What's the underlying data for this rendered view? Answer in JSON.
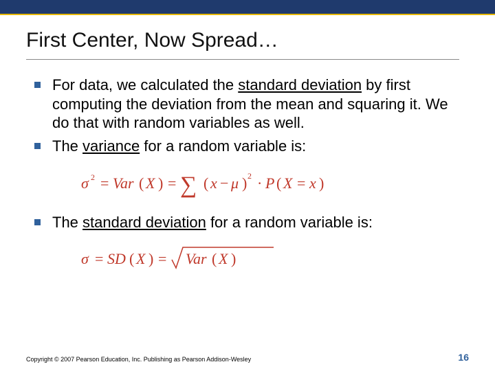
{
  "slide": {
    "title": "First Center, Now Spread…",
    "bullets": {
      "b1_a": "For data, we calculated the ",
      "b1_b": "standard deviation",
      "b1_c": " by first computing the deviation from the mean and squaring it. We do that with random variables as well.",
      "b2_a": "The ",
      "b2_b": "variance",
      "b2_c": " for a random variable is:",
      "b3_a": "The ",
      "b3_b": "standard deviation",
      "b3_c": " for a random variable is:"
    },
    "formulas": {
      "variance_plain": "σ² = Var(X) = Σ (x − μ)² · P(X = x)",
      "sd_plain": "σ = SD(X) = √Var(X)"
    },
    "footer": {
      "copyright": "Copyright © 2007 Pearson Education, Inc. Publishing as Pearson Addison-Wesley",
      "page": "16"
    },
    "colors": {
      "band": "#1f3a6d",
      "accent": "#e6b800",
      "bullet": "#30619c",
      "formula": "#c0392b"
    }
  }
}
